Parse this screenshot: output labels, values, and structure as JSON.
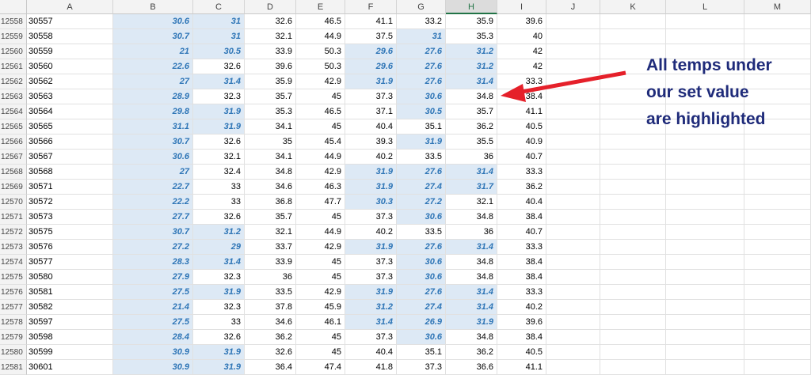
{
  "sheet": {
    "columns": [
      "A",
      "B",
      "C",
      "D",
      "E",
      "F",
      "G",
      "H",
      "I",
      "J",
      "K",
      "L",
      "M"
    ],
    "selected_column": "H",
    "rows": [
      {
        "n": "12558",
        "a": "30557",
        "b": "30.6",
        "c": "31",
        "d": "32.6",
        "e": "46.5",
        "f": "41.1",
        "g": "33.2",
        "h": "35.9",
        "i": "39.6",
        "hl": [
          "b",
          "c"
        ]
      },
      {
        "n": "12559",
        "a": "30558",
        "b": "30.7",
        "c": "31",
        "d": "32.1",
        "e": "44.9",
        "f": "37.5",
        "g": "31",
        "h": "35.3",
        "i": "40",
        "hl": [
          "b",
          "c",
          "g"
        ]
      },
      {
        "n": "12560",
        "a": "30559",
        "b": "21",
        "c": "30.5",
        "d": "33.9",
        "e": "50.3",
        "f": "29.6",
        "g": "27.6",
        "h": "31.2",
        "i": "42",
        "hl": [
          "b",
          "c",
          "f",
          "g",
          "h"
        ]
      },
      {
        "n": "12561",
        "a": "30560",
        "b": "22.6",
        "c": "32.6",
        "d": "39.6",
        "e": "50.3",
        "f": "29.6",
        "g": "27.6",
        "h": "31.2",
        "i": "42",
        "hl": [
          "b",
          "f",
          "g",
          "h"
        ]
      },
      {
        "n": "12562",
        "a": "30562",
        "b": "27",
        "c": "31.4",
        "d": "35.9",
        "e": "42.9",
        "f": "31.9",
        "g": "27.6",
        "h": "31.4",
        "i": "33.3",
        "hl": [
          "b",
          "c",
          "f",
          "g",
          "h"
        ]
      },
      {
        "n": "12563",
        "a": "30563",
        "b": "28.9",
        "c": "32.3",
        "d": "35.7",
        "e": "45",
        "f": "37.3",
        "g": "30.6",
        "h": "34.8",
        "i": "38.4",
        "hl": [
          "b",
          "g"
        ]
      },
      {
        "n": "12564",
        "a": "30564",
        "b": "29.8",
        "c": "31.9",
        "d": "35.3",
        "e": "46.5",
        "f": "37.1",
        "g": "30.5",
        "h": "35.7",
        "i": "41.1",
        "hl": [
          "b",
          "c",
          "g"
        ]
      },
      {
        "n": "12565",
        "a": "30565",
        "b": "31.1",
        "c": "31.9",
        "d": "34.1",
        "e": "45",
        "f": "40.4",
        "g": "35.1",
        "h": "36.2",
        "i": "40.5",
        "hl": [
          "b",
          "c"
        ]
      },
      {
        "n": "12566",
        "a": "30566",
        "b": "30.7",
        "c": "32.6",
        "d": "35",
        "e": "45.4",
        "f": "39.3",
        "g": "31.9",
        "h": "35.5",
        "i": "40.9",
        "hl": [
          "b",
          "g"
        ]
      },
      {
        "n": "12567",
        "a": "30567",
        "b": "30.6",
        "c": "32.1",
        "d": "34.1",
        "e": "44.9",
        "f": "40.2",
        "g": "33.5",
        "h": "36",
        "i": "40.7",
        "hl": [
          "b"
        ]
      },
      {
        "n": "12568",
        "a": "30568",
        "b": "27",
        "c": "32.4",
        "d": "34.8",
        "e": "42.9",
        "f": "31.9",
        "g": "27.6",
        "h": "31.4",
        "i": "33.3",
        "hl": [
          "b",
          "f",
          "g",
          "h"
        ]
      },
      {
        "n": "12569",
        "a": "30571",
        "b": "22.7",
        "c": "33",
        "d": "34.6",
        "e": "46.3",
        "f": "31.9",
        "g": "27.4",
        "h": "31.7",
        "i": "36.2",
        "hl": [
          "b",
          "f",
          "g",
          "h"
        ]
      },
      {
        "n": "12570",
        "a": "30572",
        "b": "22.2",
        "c": "33",
        "d": "36.8",
        "e": "47.7",
        "f": "30.3",
        "g": "27.2",
        "h": "32.1",
        "i": "40.4",
        "hl": [
          "b",
          "f",
          "g"
        ]
      },
      {
        "n": "12571",
        "a": "30573",
        "b": "27.7",
        "c": "32.6",
        "d": "35.7",
        "e": "45",
        "f": "37.3",
        "g": "30.6",
        "h": "34.8",
        "i": "38.4",
        "hl": [
          "b",
          "g"
        ]
      },
      {
        "n": "12572",
        "a": "30575",
        "b": "30.7",
        "c": "31.2",
        "d": "32.1",
        "e": "44.9",
        "f": "40.2",
        "g": "33.5",
        "h": "36",
        "i": "40.7",
        "hl": [
          "b",
          "c"
        ]
      },
      {
        "n": "12573",
        "a": "30576",
        "b": "27.2",
        "c": "29",
        "d": "33.7",
        "e": "42.9",
        "f": "31.9",
        "g": "27.6",
        "h": "31.4",
        "i": "33.3",
        "hl": [
          "b",
          "c",
          "f",
          "g",
          "h"
        ]
      },
      {
        "n": "12574",
        "a": "30577",
        "b": "28.3",
        "c": "31.4",
        "d": "33.9",
        "e": "45",
        "f": "37.3",
        "g": "30.6",
        "h": "34.8",
        "i": "38.4",
        "hl": [
          "b",
          "c",
          "g"
        ]
      },
      {
        "n": "12575",
        "a": "30580",
        "b": "27.9",
        "c": "32.3",
        "d": "36",
        "e": "45",
        "f": "37.3",
        "g": "30.6",
        "h": "34.8",
        "i": "38.4",
        "hl": [
          "b",
          "g"
        ]
      },
      {
        "n": "12576",
        "a": "30581",
        "b": "27.5",
        "c": "31.9",
        "d": "33.5",
        "e": "42.9",
        "f": "31.9",
        "g": "27.6",
        "h": "31.4",
        "i": "33.3",
        "hl": [
          "b",
          "c",
          "f",
          "g",
          "h"
        ]
      },
      {
        "n": "12577",
        "a": "30582",
        "b": "21.4",
        "c": "32.3",
        "d": "37.8",
        "e": "45.9",
        "f": "31.2",
        "g": "27.4",
        "h": "31.4",
        "i": "40.2",
        "hl": [
          "b",
          "f",
          "g",
          "h"
        ]
      },
      {
        "n": "12578",
        "a": "30597",
        "b": "27.5",
        "c": "33",
        "d": "34.6",
        "e": "46.1",
        "f": "31.4",
        "g": "26.9",
        "h": "31.9",
        "i": "39.6",
        "hl": [
          "b",
          "f",
          "g",
          "h"
        ]
      },
      {
        "n": "12579",
        "a": "30598",
        "b": "28.4",
        "c": "32.6",
        "d": "36.2",
        "e": "45",
        "f": "37.3",
        "g": "30.6",
        "h": "34.8",
        "i": "38.4",
        "hl": [
          "b",
          "g"
        ]
      },
      {
        "n": "12580",
        "a": "30599",
        "b": "30.9",
        "c": "31.9",
        "d": "32.6",
        "e": "45",
        "f": "40.4",
        "g": "35.1",
        "h": "36.2",
        "i": "40.5",
        "hl": [
          "b",
          "c"
        ]
      },
      {
        "n": "12581",
        "a": "30601",
        "b": "30.9",
        "c": "31.9",
        "d": "36.4",
        "e": "47.4",
        "f": "41.8",
        "g": "37.3",
        "h": "36.6",
        "i": "41.1",
        "hl": [
          "b",
          "c"
        ]
      }
    ]
  },
  "annotation": {
    "text": "All temps under\nour set value\nare highlighted",
    "color": "#1f2b7a"
  },
  "arrow": {
    "color": "#e5202a"
  },
  "highlight": {
    "fill": "#dde9f5",
    "text_color": "#2e75b6"
  }
}
